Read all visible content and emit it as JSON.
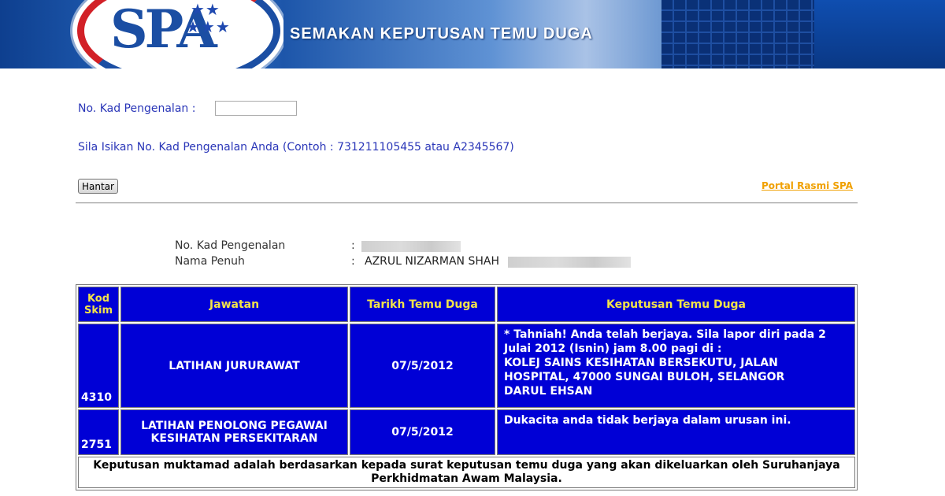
{
  "banner": {
    "title": "SEMAKAN KEPUTUSAN TEMU DUGA",
    "logo_text": "SPA",
    "logo_icon": "spa-logo"
  },
  "form": {
    "ic_label": "No. Kad Pengenalan :",
    "ic_value": "",
    "ic_placeholder": "",
    "hint": "Sila Isikan No. Kad Pengenalan Anda (Contoh : 731211105455 atau A2345567)",
    "submit_label": "Hantar",
    "portal_link": "Portal Rasmi SPA"
  },
  "candidate": {
    "ic_label": "No. Kad Pengenalan",
    "ic_value_redacted": true,
    "name_label": "Nama Penuh",
    "name_value": "AZRUL NIZARMAN SHAH",
    "colon": ":"
  },
  "results": {
    "headers": {
      "kod_line1": "Kod",
      "kod_line2": "Skim",
      "jawatan": "Jawatan",
      "tarikh": "Tarikh Temu Duga",
      "keputusan": "Keputusan Temu Duga"
    },
    "rows": [
      {
        "kod": "4310",
        "jawatan": "LATIHAN JURURAWAT",
        "tarikh": "07/5/2012",
        "keputusan_lines": [
          "* Tahniah! Anda telah berjaya. Sila lapor diri pada 2",
          "Julai 2012 (Isnin) jam 8.00 pagi di :",
          "KOLEJ SAINS KESIHATAN BERSEKUTU, JALAN",
          "HOSPITAL, 47000 SUNGAI BULOH, SELANGOR",
          "DARUL EHSAN"
        ]
      },
      {
        "kod": "2751",
        "jawatan_line1": "LATIHAN PENOLONG PEGAWAI",
        "jawatan_line2": "KESIHATAN PERSEKITARAN",
        "tarikh": "07/5/2012",
        "keputusan": "Dukacita anda tidak berjaya dalam urusan ini."
      }
    ],
    "footer_line1": "Keputusan muktamad adalah berdasarkan kepada surat keputusan temu duga yang akan dikeluarkan oleh Suruhanjaya",
    "footer_line2": "Perkhidmatan Awam Malaysia."
  },
  "colors": {
    "banner_blue": "#0d3f93",
    "label_blue": "#2a36b8",
    "link_orange": "#f0a000",
    "table_blue": "#0000d6",
    "header_yellow": "#f2e34a"
  }
}
